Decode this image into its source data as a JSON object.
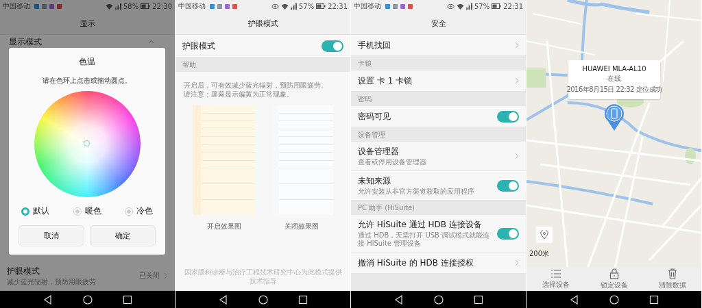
{
  "display_screen": {
    "status_bar": {
      "carrier": "中国移动",
      "eye_comfort_icon": false,
      "battery": "58%",
      "time": "22:30"
    },
    "title": "显示",
    "top_row": "显示模式",
    "dialog": {
      "title": "色温",
      "hint": "请在色环上点击或拖动圆点。",
      "options": [
        {
          "label": "默认",
          "selected": true
        },
        {
          "label": "暖色",
          "selected": false
        },
        {
          "label": "冷色",
          "selected": false
        }
      ],
      "buttons": [
        "取消",
        "确定"
      ]
    },
    "bottom_row": {
      "title": "护眼模式",
      "subtitle": "减少蓝光辐射，预防用眼疲劳",
      "value": "已关闭"
    }
  },
  "eye_comfort_screen": {
    "status_bar": {
      "carrier": "中国移动",
      "eye_comfort_icon": true,
      "battery": "57%",
      "time": "22:31"
    },
    "title": "护眼模式",
    "toggle": {
      "label": "护眼模式",
      "on": true
    },
    "section": "帮助",
    "description": [
      "开启后，可有效减少蓝光辐射，预防用眼疲劳。",
      "请注意：屏幕显示偏黄为正常现象。"
    ],
    "previews": [
      {
        "caption": "开启效果图",
        "kind": "warm"
      },
      {
        "caption": "关闭效果图",
        "kind": "plain"
      }
    ],
    "footer": "国家眼科诊断与治疗工程技术研究中心为此模式提供技术指导"
  },
  "security_screen": {
    "status_bar": {
      "carrier": "中国移动",
      "eye_comfort_icon": true,
      "battery": "57%",
      "time": "22:31"
    },
    "title": "安全",
    "items": [
      {
        "kind": "link",
        "title": "手机找回"
      },
      {
        "kind": "section",
        "title": "卡锁"
      },
      {
        "kind": "link",
        "title": "设置 卡 1 卡锁"
      },
      {
        "kind": "section",
        "title": "密码"
      },
      {
        "kind": "toggle",
        "title": "密码可见",
        "on": true
      },
      {
        "kind": "section",
        "title": "设备管理"
      },
      {
        "kind": "link",
        "title": "设备管理器",
        "subtitle": "查看或停用设备管理器"
      },
      {
        "kind": "toggle",
        "title": "未知来源",
        "subtitle": "允许安装从非官方渠道获取的应用程序",
        "on": true
      },
      {
        "kind": "section",
        "title": "PC 助手 (HiSuite)"
      },
      {
        "kind": "toggle",
        "title": "允许 HiSuite 通过 HDB 连接设备",
        "subtitle": "通过 HDB，无需打开 USB 调试模式就能连接 HiSuite 管理设备",
        "on": true
      },
      {
        "kind": "link",
        "title": "撤消 HiSuite 的 HDB 连接授权"
      }
    ]
  },
  "find_phone_screen": {
    "popup": {
      "device": "HUAWEI MLA-AL10",
      "status": "在线",
      "located": "2016年8月15日 22:32 定位成功"
    },
    "scale": "200米",
    "actions": [
      {
        "kind": "list",
        "label": "选择设备"
      },
      {
        "kind": "lock",
        "label": "锁定设备"
      },
      {
        "kind": "trash",
        "label": "清除数据"
      }
    ]
  }
}
